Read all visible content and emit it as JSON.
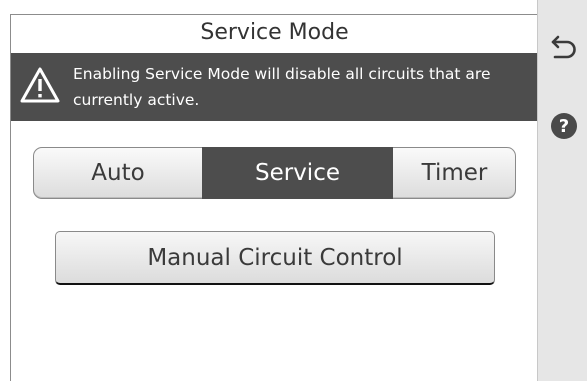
{
  "screen": {
    "title": "Service Mode",
    "warning": {
      "icon": "warning-triangle-icon",
      "text": "Enabling Service Mode will disable all circuits that are currently active."
    },
    "mode_selector": {
      "options": [
        "Auto",
        "Service",
        "Timer"
      ],
      "selected": "Service"
    },
    "manual_button_label": "Manual Circuit Control"
  },
  "side_rail": {
    "back_icon": "back-arrow-icon",
    "help_icon": "help-icon",
    "help_glyph": "?"
  },
  "colors": {
    "banner": "#4d4d4d",
    "selected_segment": "#4d4d4d",
    "rail": "#e6e6e6"
  }
}
